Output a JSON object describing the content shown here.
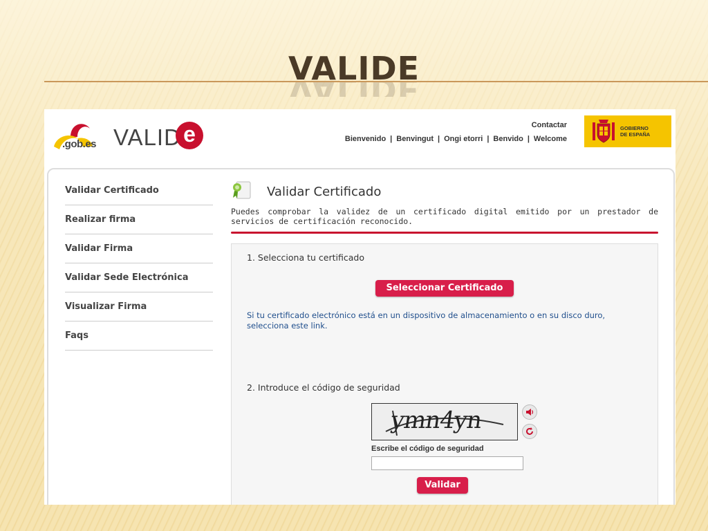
{
  "slide": {
    "title": "VALIDE"
  },
  "header": {
    "gob_logo_text": ".gob.es",
    "valide_word": "VALID",
    "valide_e": "e",
    "contact_label": "Contactar",
    "languages": [
      "Bienvenido",
      "Benvingut",
      "Ongi etorri",
      "Benvido",
      "Welcome"
    ],
    "gobierno_line1": "GOBIERNO",
    "gobierno_line2": "DE ESPAÑA"
  },
  "sidebar": {
    "items": [
      {
        "label": "Validar Certificado"
      },
      {
        "label": "Realizar firma"
      },
      {
        "label": "Validar Firma"
      },
      {
        "label": "Validar Sede Electrónica"
      },
      {
        "label": "Visualizar Firma"
      },
      {
        "label": "Faqs"
      }
    ]
  },
  "main": {
    "title": "Validar Certificado",
    "intro": "Puedes comprobar la validez de un certificado digital emitido por un prestador de servicios de certificación reconocido.",
    "step1_label": "1. Selecciona tu certificado",
    "select_button": "Seleccionar Certificado",
    "link_text": "Si tu certificado electrónico está en un dispositivo de almacenamiento o en su disco duro, selecciona este link.",
    "step2_label": "2. Introduce el código de seguridad",
    "captcha_text": "ymn4yn",
    "captcha_label": "Escribe el código de seguridad",
    "captcha_input_value": "",
    "submit_button": "Validar"
  },
  "colors": {
    "accent": "#c8102e",
    "button": "#d81e4a",
    "link": "#1f4e8c"
  }
}
